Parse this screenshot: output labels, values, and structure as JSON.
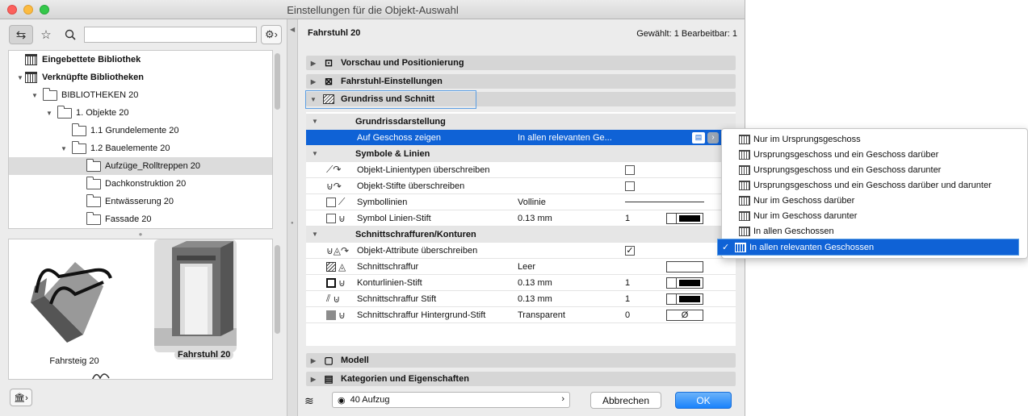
{
  "window": {
    "title": "Einstellungen für die Objekt-Auswahl"
  },
  "library": {
    "search_placeholder": "",
    "tree": [
      {
        "label": "Eingebettete Bibliothek",
        "level": 0,
        "bold": true,
        "expanded": false,
        "icon": "library-icon"
      },
      {
        "label": "Verknüpfte Bibliotheken",
        "level": 0,
        "bold": true,
        "expanded": true,
        "icon": "library-icon"
      },
      {
        "label": "BIBLIOTHEKEN 20",
        "level": 1,
        "expanded": true,
        "icon": "folder-icon"
      },
      {
        "label": "1. Objekte 20",
        "level": 2,
        "expanded": true,
        "icon": "folder-icon"
      },
      {
        "label": "1.1 Grundelemente 20",
        "level": 3,
        "expanded": false,
        "icon": "folder-icon"
      },
      {
        "label": "1.2 Bauelemente 20",
        "level": 3,
        "expanded": true,
        "icon": "folder-icon"
      },
      {
        "label": "Aufzüge_Rolltreppen 20",
        "level": 4,
        "expanded": false,
        "icon": "folder-icon",
        "selected": true
      },
      {
        "label": "Dachkonstruktion 20",
        "level": 4,
        "expanded": false,
        "icon": "folder-icon"
      },
      {
        "label": "Entwässerung 20",
        "level": 4,
        "expanded": false,
        "icon": "folder-icon"
      },
      {
        "label": "Fassade 20",
        "level": 4,
        "expanded": false,
        "icon": "folder-icon"
      }
    ],
    "previews": [
      {
        "label": "Fahrsteig 20",
        "selected": false
      },
      {
        "label": "Fahrstuhl 20",
        "selected": true
      }
    ]
  },
  "header": {
    "title": "Fahrstuhl 20",
    "selection": "Gewählt: 1 Bearbeitbar: 1"
  },
  "sections": {
    "vorschau": "Vorschau und Positionierung",
    "fahrstuhl": "Fahrstuhl-Einstellungen",
    "grundriss": "Grundriss und Schnitt",
    "modell": "Modell",
    "kategorien": "Kategorien und Eigenschaften"
  },
  "params": {
    "g1": "Grundrissdarstellung",
    "auf_geschoss": {
      "name": "Auf Geschoss zeigen",
      "value": "In allen relevanten Ge..."
    },
    "g2": "Symbole & Linien",
    "linientypen": {
      "name": "Objekt-Linientypen überschreiben",
      "checked": false
    },
    "stifte": {
      "name": "Objekt-Stifte überschreiben",
      "checked": false
    },
    "symbollinien": {
      "name": "Symbollinien",
      "value": "Vollinie"
    },
    "symbol_stift": {
      "name": "Symbol Linien-Stift",
      "value": "0.13 mm",
      "num": "1"
    },
    "g3": "Schnittschraffuren/Konturen",
    "attribute": {
      "name": "Objekt-Attribute überschreiben",
      "checked": true,
      "mark": "✓"
    },
    "schraffur": {
      "name": "Schnittschraffur",
      "value": "Leer"
    },
    "kontur": {
      "name": "Konturlinien-Stift",
      "value": "0.13 mm",
      "num": "1"
    },
    "schraffur_stift": {
      "name": "Schnittschraffur Stift",
      "value": "0.13 mm",
      "num": "1"
    },
    "hintergrund": {
      "name": "Schnittschraffur Hintergrund-Stift",
      "value": "Transparent",
      "num": "0",
      "pen_symbol": "Ø"
    }
  },
  "footer": {
    "layer": "40 Aufzug",
    "cancel": "Abbrechen",
    "ok": "OK"
  },
  "dropdown": {
    "items": [
      "Nur im Ursprungsgeschoss",
      "Ursprungsgeschoss und ein Geschoss darüber",
      "Ursprungsgeschoss und ein Geschoss darunter",
      "Ursprungsgeschoss und ein Geschoss darüber und darunter",
      "Nur im Geschoss darüber",
      "Nur im Geschoss darunter",
      "In allen Geschossen",
      "In allen relevanten Geschossen"
    ],
    "selected_index": 7,
    "check": "✓"
  },
  "colors": {
    "accent": "#0f62d6",
    "ok_button": "#1a82fb"
  }
}
